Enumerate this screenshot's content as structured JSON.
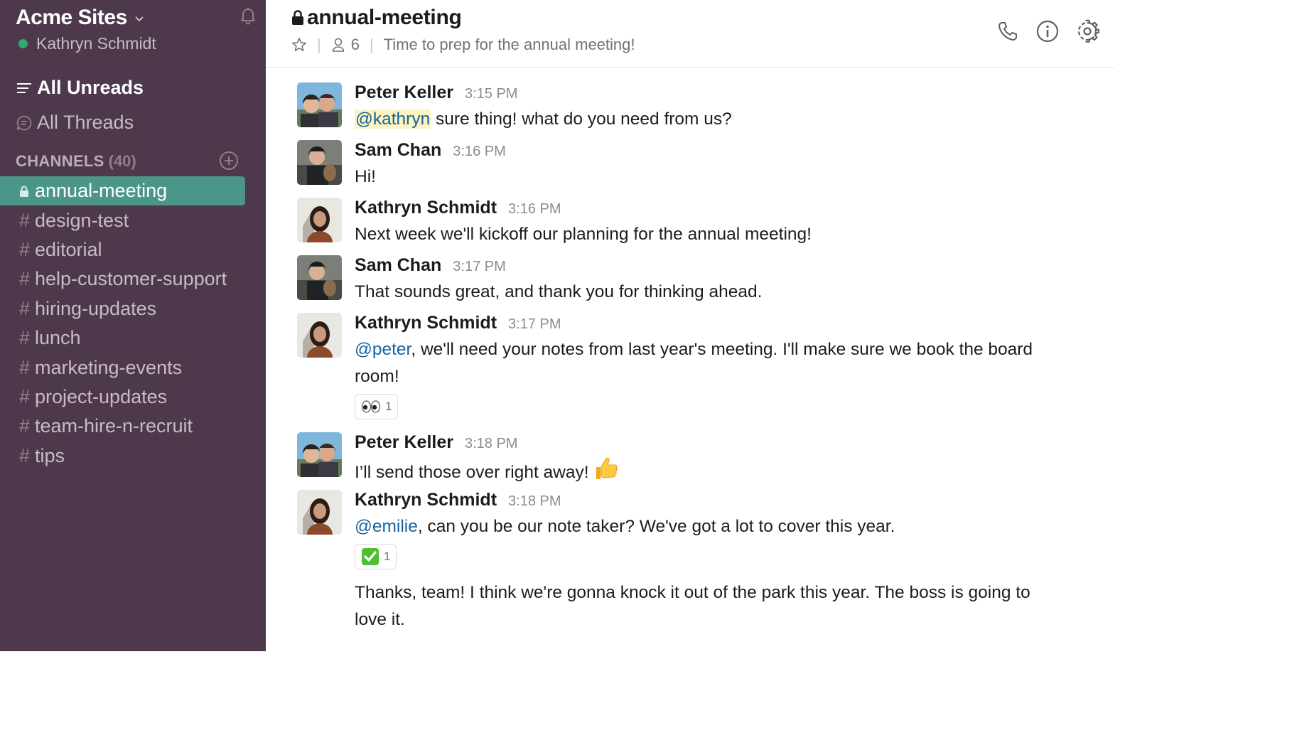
{
  "team": {
    "name": "Acme Sites",
    "user": "Kathryn Schmidt"
  },
  "nav": {
    "all_unreads": "All Unreads",
    "all_threads": "All Threads"
  },
  "channels": {
    "title": "CHANNELS",
    "count": "(40)",
    "items": [
      {
        "name": "annual-meeting",
        "private": true,
        "active": true
      },
      {
        "name": "design-test"
      },
      {
        "name": "editorial"
      },
      {
        "name": "help-customer-support"
      },
      {
        "name": "hiring-updates"
      },
      {
        "name": "lunch"
      },
      {
        "name": "marketing-events"
      },
      {
        "name": "project-updates"
      },
      {
        "name": "team-hire-n-recruit"
      },
      {
        "name": "tips"
      }
    ],
    "hash": "#"
  },
  "header": {
    "title": "annual-meeting",
    "members": "6",
    "separator": "|",
    "topic": "Time to prep for the annual meeting!"
  },
  "messages": [
    {
      "author": "Peter Keller",
      "time": "3:15 PM",
      "mention": "@kathryn",
      "text": " sure thing! what do you need from us?"
    },
    {
      "author": "Sam Chan",
      "time": "3:16 PM",
      "text": "Hi!"
    },
    {
      "author": "Kathryn Schmidt",
      "time": "3:16 PM",
      "text": "Next week we'll kickoff our planning for the annual meeting!"
    },
    {
      "author": "Sam Chan",
      "time": "3:17 PM",
      "text": "That sounds great, and thank you for thinking ahead."
    },
    {
      "author": "Kathryn Schmidt",
      "time": "3:17 PM",
      "mention": "@peter",
      "text": ", we'll need your notes from last year's meeting. I'll make sure we book the board room!",
      "reaction": {
        "emoji": "eyes-emoji",
        "count": "1"
      }
    },
    {
      "author": "Peter Keller",
      "time": "3:18 PM",
      "text": "I’ll send those over right away!",
      "emoji": "thumbs-up-emoji"
    },
    {
      "author": "Kathryn Schmidt",
      "time": "3:18 PM",
      "mention": "@emilie",
      "text": ", can you be our note taker? We've got a lot to cover this year.",
      "reaction": {
        "emoji": "check-mark-emoji",
        "count": "1"
      }
    },
    {
      "text": "Thanks, team! I think we're gonna knock it out of the park this year. The boss is going to love it."
    }
  ],
  "colors": {
    "sidebar_bg": "#4d394b",
    "active_channel": "#4c9689",
    "presence": "#2bac76",
    "mention": "#1264a3",
    "mention_highlight": "#fdf3c0"
  }
}
